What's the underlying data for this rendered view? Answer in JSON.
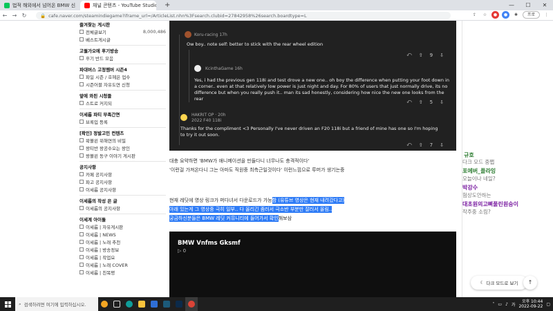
{
  "browser": {
    "tabs": [
      {
        "title": "법적 해외에서 넘어온 BMW 신..."
      },
      {
        "title": "채널 콘텐츠 - YouTube Studio"
      }
    ],
    "new_tab": "+",
    "url": "cafe.naver.com/steamindiegame?iframe_url=/ArticleList.nhn%3Fsearch.clubid=27842958%26search.boardtype=L",
    "profile": "프로",
    "window": {
      "minimize": "—",
      "maximize": "☐",
      "close": "✕"
    }
  },
  "sidebar": {
    "items": [
      {
        "label": "즐겨찾는 게시판",
        "type": "head"
      },
      {
        "label": "전체글보기",
        "count": "8,000,486"
      },
      {
        "label": "베스트게시글"
      },
      {
        "label": "고퀄가오에 후기방송",
        "type": "head"
      },
      {
        "label": "후기 반드 모음"
      },
      {
        "label": "파대버스 고정멤버 시즌4",
        "type": "head"
      },
      {
        "label": "파일 시즌 / 호헤은 업수"
      },
      {
        "label": "시즌어블 자유도연 신청"
      },
      {
        "label": "앞에 와된 시청들",
        "type": "head"
      },
      {
        "label": "스트로 커지되"
      },
      {
        "label": "이세롭 파티 부족간면",
        "type": "head"
      },
      {
        "label": "브록입 등록"
      },
      {
        "label": "[확인] 정발고민 컨텐츠",
        "type": "head"
      },
      {
        "label": "왁볼왼 위해연의 비밀"
      },
      {
        "label": "왕티반 왕공수오는 왕인"
      },
      {
        "label": "왕볼왼 동구 이야기 게시판"
      },
      {
        "label": "공지사항",
        "type": "head"
      },
      {
        "label": "카페 공지사항"
      },
      {
        "label": "파고 공지사항"
      },
      {
        "label": "이세롭 공지사항"
      },
      {
        "label": "이세롭의 작성 은 글",
        "type": "head"
      },
      {
        "label": "이세롭의 공지사항"
      },
      {
        "label": "이세계 아이돌",
        "type": "head"
      },
      {
        "label": "이세롭 | 자유게시판"
      },
      {
        "label": "이세롭 | NEWS"
      },
      {
        "label": "이세롭 | 노래 추천"
      },
      {
        "label": "이세롭 | 방송정보"
      },
      {
        "label": "이세롭 | 작업요"
      },
      {
        "label": "이세롭 | 노래 COVER"
      },
      {
        "label": "이세롭 | 친목평"
      }
    ]
  },
  "comments": [
    {
      "author": "Koru-racing 17h",
      "text": "Ow boy.. note self: better to stick with the rear wheel edition",
      "likes": "9"
    },
    {
      "author": "KcinthaGame 16h",
      "text": "Yes, i had the previous gen 118i and test drove a new one.. oh boy the difference when putting your foot down in a corner.. even at that relatively low power is just night and day. For 80% of users that just normally drive, its no difference but when you really push it.. man its sad honestly, considering how nice the new one looks from the rear",
      "likes": "5"
    },
    {
      "author": "HAKRIT OP · 20h",
      "meta": "2022 F40 118i",
      "text": "Thanks for the compliment <3 Personally I've never driven an F20 118i but a friend of mine has one so I'm hoping to try it out soon.",
      "likes": "7"
    }
  ],
  "article": {
    "p1": "대충 요약하면 'BMW가 애니메이션을 만들다니 너무나도 충격적이다'",
    "p2": "'이런걸 가져온다니 그는 아마도 직원중 최측근일것이다' 이런느낌으로 루머가 생기는중",
    "h1a": "현재 레딧에 영상 링크가 퍼다녀서 다운로드가 가능",
    "h1b": "함 (유튜브 영상은 현재 내려갔다고)",
    "h2": "아래 있는게 그 영상중 극히 일부.. 다 올리긴 좀러서 극소반 부분만 잘러서 올림..",
    "h3a": "궁금하신분들은 BMW 레딧 커뮤니티에 들어가서 확인",
    "h3b": "해보삼"
  },
  "video": {
    "title": "BMW Vnfms Gksmf",
    "subtitle": "▷ 0"
  },
  "chat": [
    {
      "name": "규호",
      "color": "#2e7d32",
      "msg": "다크 모드 중쨉"
    },
    {
      "name": "포에버_플라잉",
      "color": "#2e7d32",
      "msg": "오늘이나 네일?"
    },
    {
      "name": "박강수",
      "color": "#7b1fa2",
      "msg": "험상도안하는"
    },
    {
      "name": "대초원의고삐풀린원숭이",
      "color": "#7b1fa2",
      "msg": "작주중 소림?"
    }
  ],
  "panel": {
    "dark_mode": "다크 모드로 보기",
    "top": "↑"
  },
  "taskbar": {
    "search": "검색하려면 여기에 입력하십시오.",
    "time": "오후 10:44",
    "date": "2022-09-22",
    "ime": "가"
  },
  "colors": {
    "accent": "#2f7cf6",
    "dark": "#212121"
  }
}
